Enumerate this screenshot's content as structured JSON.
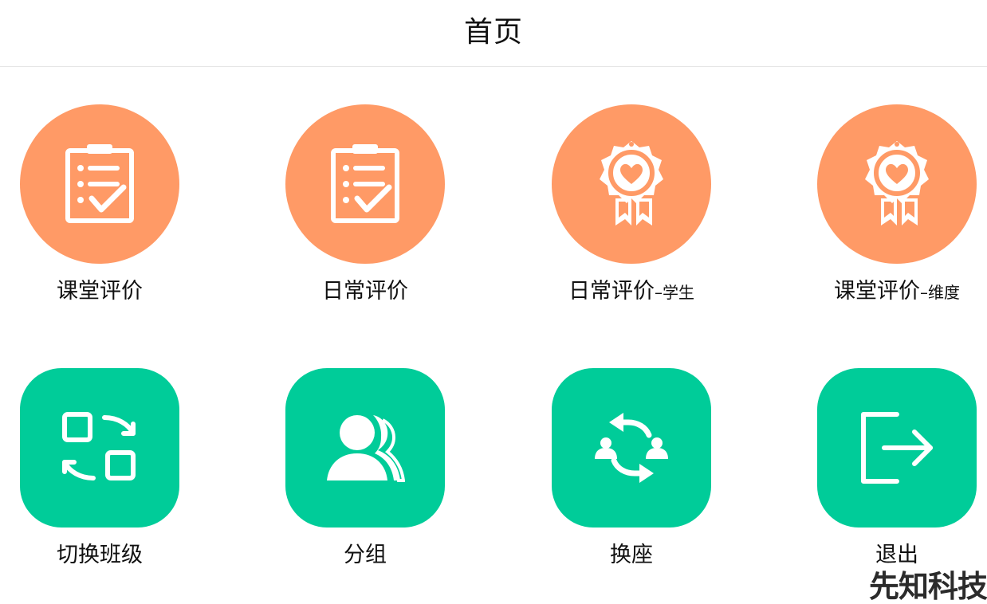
{
  "header": {
    "title": "首页"
  },
  "colors": {
    "orange": "#FF9A66",
    "green": "#00CC99",
    "icon": "#ffffff"
  },
  "tiles": [
    {
      "label": "课堂评价",
      "suffix": "",
      "icon": "clipboard-check-icon"
    },
    {
      "label": "日常评价",
      "suffix": "",
      "icon": "clipboard-check-icon"
    },
    {
      "label": "日常评价",
      "suffix": "–学生",
      "icon": "award-heart-icon"
    },
    {
      "label": "课堂评价",
      "suffix": "–维度",
      "icon": "award-heart-icon"
    },
    {
      "label": "切换班级",
      "suffix": "",
      "icon": "switch-class-icon"
    },
    {
      "label": "分组",
      "suffix": "",
      "icon": "group-users-icon"
    },
    {
      "label": "换座",
      "suffix": "",
      "icon": "swap-seat-icon"
    },
    {
      "label": "退出",
      "suffix": "",
      "icon": "logout-icon"
    }
  ],
  "watermark": "先知科技"
}
